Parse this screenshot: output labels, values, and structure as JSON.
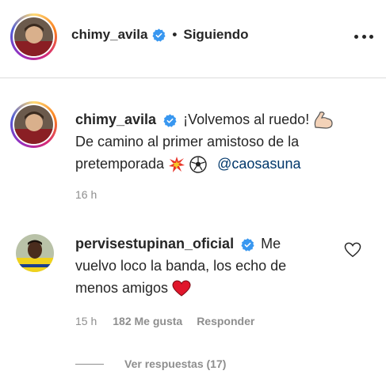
{
  "header": {
    "username": "chimy_avila",
    "separator": "•",
    "follow_state": "Siguiendo"
  },
  "post": {
    "username": "chimy_avila",
    "caption_line1": "¡Volvemos al ruedo!",
    "caption_line2": "De camino al primer amistoso de la",
    "caption_line3": "pretemporada",
    "mention": "@caosasuna",
    "time": "16 h"
  },
  "comment": {
    "username": "pervisestupinan_oficial",
    "text_a": "Me",
    "text_b": "vuelvo loco la banda, los echo de",
    "text_c": "menos amigos",
    "time": "15 h",
    "likes": "182 Me gusta",
    "reply_label": "Responder",
    "view_replies": "Ver respuestas (17)"
  },
  "colors": {
    "verified": "#3897f0",
    "mention": "#00376b",
    "muted": "#8e8e8e",
    "heart": "#ed4956"
  }
}
